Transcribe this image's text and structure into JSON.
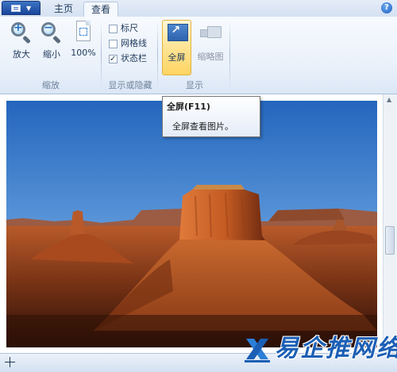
{
  "tabs": {
    "home": "主页",
    "view": "查看"
  },
  "help": "?",
  "zoom_group": {
    "zoom_in": "放大",
    "zoom_out": "缩小",
    "actual_size": "100%",
    "label": "缩放"
  },
  "show_hide_group": {
    "ruler": {
      "label": "标尺",
      "checked": false
    },
    "gridlines": {
      "label": "网格线",
      "checked": false
    },
    "status_bar": {
      "label": "状态栏",
      "checked": true
    },
    "label": "显示或隐藏"
  },
  "display_group": {
    "full_screen": "全屏",
    "thumbnail": "缩略图",
    "label": "显示"
  },
  "tooltip": {
    "title": "全屏(F11)",
    "description": "全屏查看图片。"
  },
  "watermark": {
    "text": "易企推网络"
  },
  "colors": {
    "accent": "#1e395b",
    "highlight": "#ffd462",
    "brand": "#1b5fb5"
  }
}
